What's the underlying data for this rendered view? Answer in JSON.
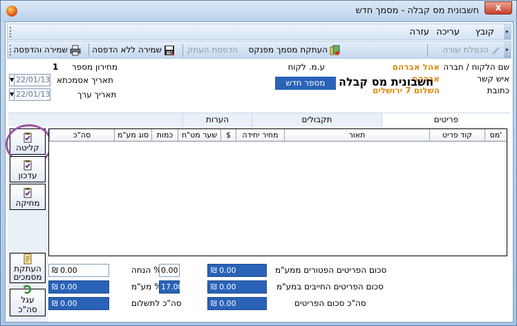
{
  "window": {
    "title": "חשבונית מס קבלה -  מסמך חדש",
    "close": "x"
  },
  "menu": {
    "file": "קובץ",
    "edit": "עריכה",
    "help": "עזרה"
  },
  "toolbar": {
    "copy_line": "הכפלת שורה",
    "copy_from_book": "העתקת מסמך מפנקס",
    "print_copy": "הדפסת העתק",
    "save_no_print": "שמירה ללא הדפסה",
    "save_print": "שמירה והדפסה"
  },
  "header": {
    "client_label": "שם הלקוח / חברה",
    "client_value": "אהל אברהם",
    "contact_label": "איש קשר",
    "contact_value": "אברהם",
    "address_label": "כתובת",
    "address_value": "השלום 7 ירושלים",
    "vat_label": "ע.מ. לקוח",
    "price_list_label": "מחירון מספר",
    "price_list_value": "1",
    "ref_date_label": "תאריך אסמכתא",
    "ref_date_value": "22/01/13",
    "value_date_label": "תאריך ערך",
    "value_date_value": "22/01/13",
    "doc_title": "חשבונית מס קבלה",
    "doc_number": "מספר חדש"
  },
  "tabs": [
    "פריטים",
    "תקבולים",
    "הערות"
  ],
  "side_buttons": {
    "capture": "קליטה",
    "update": "עדכון",
    "delete": "מחיקה",
    "copy_docs_line1": "העתקת",
    "copy_docs_line2": "מסמכים",
    "round_total": "עגל סה\"כ"
  },
  "grid": {
    "columns": [
      "מס'",
      "קוד פריט",
      "תאור",
      "מחיר יחידה",
      "$",
      "שער מט\"ח",
      "כמות",
      "סוג מע\"מ",
      "סה\"כ"
    ]
  },
  "totals": {
    "exempt_label": "סכום הפריטים הפטורים ממע\"מ",
    "exempt_value": "₪ 0.00",
    "taxable_label": "סכום הפריטים החייבים במע\"מ",
    "taxable_value": "₪ 0.00",
    "items_total_label": "סה\"כ סכום הפריטים",
    "items_total_value": "₪ 0.00",
    "discount_label": "% הנחה",
    "discount_value": "0.00",
    "vat_label": "% מע\"מ",
    "vat_value": "17.00",
    "to_pay_label": "סה\"כ לתשלום",
    "amount1": "₪ 0.00",
    "amount2": "₪ 0.00",
    "amount3": "₪ 0.00"
  }
}
